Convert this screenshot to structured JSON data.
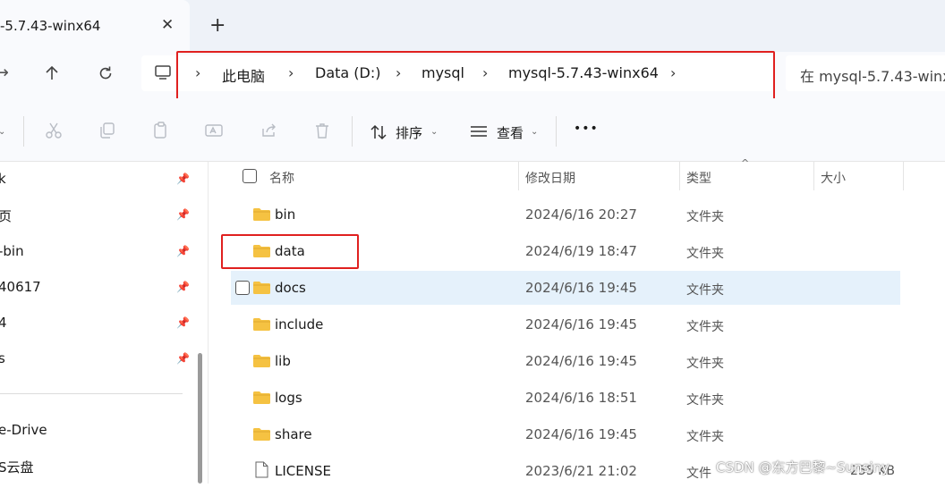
{
  "tab": {
    "title": "-5.7.43-winx64",
    "close_glyph": "✕",
    "new_tab_glyph": "+"
  },
  "breadcrumb": [
    {
      "label": "此电脑"
    },
    {
      "label": "Data (D:)"
    },
    {
      "label": "mysql"
    },
    {
      "label": "mysql-5.7.43-winx64"
    }
  ],
  "search": {
    "placeholder": "在 mysql-5.7.43-winx"
  },
  "toolbar": {
    "sort_label": "排序",
    "view_label": "查看",
    "more_label": "•••"
  },
  "sidebar": {
    "items": [
      {
        "label": "k",
        "pinned": true
      },
      {
        "label": "页",
        "pinned": true
      },
      {
        "label": "-bin",
        "pinned": true
      },
      {
        "label": "40617",
        "pinned": true
      },
      {
        "label": "4",
        "pinned": true
      },
      {
        "label": "s",
        "pinned": true
      }
    ],
    "drives": [
      {
        "label": "e-Drive"
      },
      {
        "label": "S云盘"
      }
    ]
  },
  "columns": {
    "name": "名称",
    "date": "修改日期",
    "type": "类型",
    "size": "大小"
  },
  "files": [
    {
      "name": "bin",
      "date": "2024/6/16 20:27",
      "type": "文件夹",
      "size": "",
      "icon": "folder-icon"
    },
    {
      "name": "data",
      "date": "2024/6/19 18:47",
      "type": "文件夹",
      "size": "",
      "icon": "folder-icon"
    },
    {
      "name": "docs",
      "date": "2024/6/16 19:45",
      "type": "文件夹",
      "size": "",
      "icon": "folder-icon"
    },
    {
      "name": "include",
      "date": "2024/6/16 19:45",
      "type": "文件夹",
      "size": "",
      "icon": "folder-icon"
    },
    {
      "name": "lib",
      "date": "2024/6/16 19:45",
      "type": "文件夹",
      "size": "",
      "icon": "folder-icon"
    },
    {
      "name": "logs",
      "date": "2024/6/16 18:51",
      "type": "文件夹",
      "size": "",
      "icon": "folder-icon"
    },
    {
      "name": "share",
      "date": "2024/6/16 19:45",
      "type": "文件夹",
      "size": "",
      "icon": "folder-icon"
    },
    {
      "name": "LICENSE",
      "date": "2023/6/21 21:02",
      "type": "文件",
      "size": "255 KB",
      "icon": "file-icon"
    }
  ],
  "watermark": "CSDN @东方巴黎~Sunsiny",
  "colors": {
    "highlight_red": "#e0201f",
    "folder_yellow": "#f5c242",
    "hover_row": "#e5f1fb"
  }
}
